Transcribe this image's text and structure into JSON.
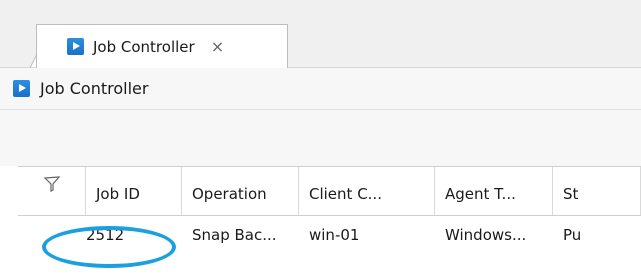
{
  "tab": {
    "label": "Job Controller",
    "close_symbol": "×",
    "icon": "run-icon"
  },
  "view": {
    "title": "Job Controller",
    "icon": "run-icon"
  },
  "table": {
    "filter_icon": "filter-icon",
    "columns": [
      "Job ID",
      "Operation",
      "Client C...",
      "Agent T...",
      "St"
    ],
    "rows": [
      {
        "job_id": "2512",
        "operation": "Snap Bac...",
        "client": "win-01",
        "agent": "Windows...",
        "status": "Pu"
      }
    ]
  },
  "colors": {
    "accent": "#1a6fc7",
    "highlight": "#1aa0e0"
  }
}
